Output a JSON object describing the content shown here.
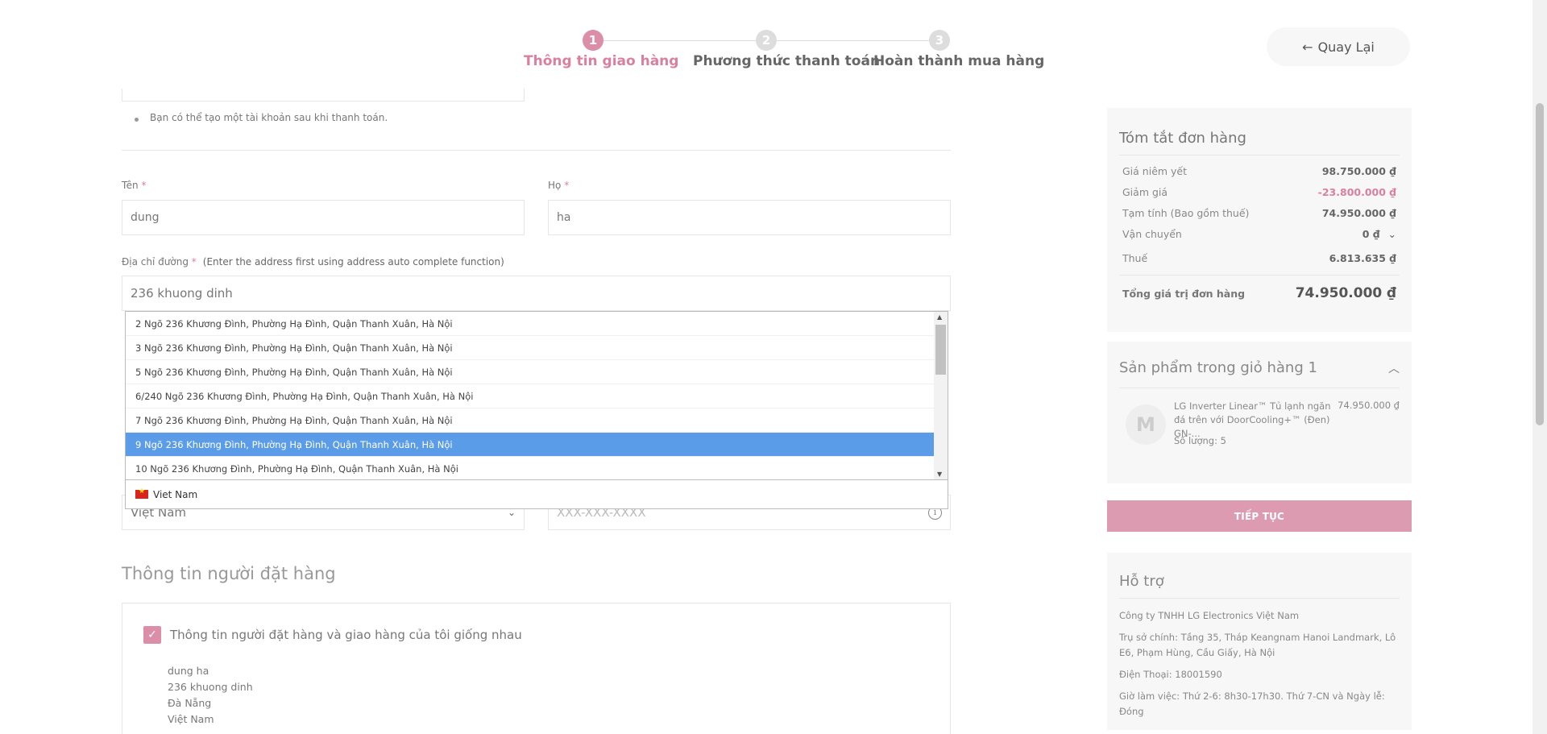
{
  "stepper": {
    "steps": [
      {
        "num": "1",
        "label": "Thông tin giao hàng"
      },
      {
        "num": "2",
        "label": "Phương thức thanh toán"
      },
      {
        "num": "3",
        "label": "Hoàn thành mua hàng"
      }
    ],
    "back_label": "Quay Lại"
  },
  "form": {
    "note": "Bạn có thể tạo một tài khoản sau khi thanh toán.",
    "first_name_label": "Tên",
    "first_name_value": "dung",
    "last_name_label": "Họ",
    "last_name_value": "ha",
    "street_label": "Địa chỉ đường",
    "street_hint": "(Enter the address first using address auto complete function)",
    "street_value": "236 khuong dinh",
    "required_mark": "*",
    "country_value": "Việt Nam",
    "phone_placeholder": "XXX-XXX-XXXX"
  },
  "autocomplete": {
    "items": [
      "2 Ngõ 236 Khương Đình, Phường Hạ Đình, Quận Thanh Xuân, Hà Nội",
      "3 Ngõ 236 Khương Đình, Phường Hạ Đình, Quận Thanh Xuân, Hà Nội",
      "5 Ngõ 236 Khương Đình, Phường Hạ Đình, Quận Thanh Xuân, Hà Nội",
      "6/240 Ngõ 236 Khương Đình, Phường Hạ Đình, Quận Thanh Xuân, Hà Nội",
      "7 Ngõ 236 Khương Đình, Phường Hạ Đình, Quận Thanh Xuân, Hà Nội",
      "9 Ngõ 236 Khương Đình, Phường Hạ Đình, Quận Thanh Xuân, Hà Nội",
      "10 Ngõ 236 Khương Đình, Phường Hạ Đình, Quận Thanh Xuân, Hà Nội"
    ],
    "selected_index": 5,
    "country_option": "Viet Nam"
  },
  "orderer": {
    "title": "Thông tin người đặt hàng",
    "same_label": "Thông tin người đặt hàng và giao hàng của tôi giống nhau",
    "lines": [
      "dung ha",
      "236 khuong dinh",
      "Đà Nẵng",
      "Việt Nam"
    ]
  },
  "summary": {
    "title": "Tóm tắt đơn hàng",
    "rows": [
      {
        "k": "Giá niêm yết",
        "v": "98.750.000 ₫"
      },
      {
        "k": "Giảm giá",
        "v": "-23.800.000 ₫"
      },
      {
        "k": "Tạm tính (Bao gồm thuế)",
        "v": "74.950.000 ₫"
      },
      {
        "k": "Vận chuyển",
        "v": "0 ₫"
      },
      {
        "k": "Thuế",
        "v": "6.813.635 ₫"
      }
    ],
    "total_label": "Tổng giá trị đơn hàng",
    "total_value": "74.950.000 ₫"
  },
  "cart": {
    "title": "Sản phẩm trong giỏ hàng 1",
    "product_name": "LG Inverter Linear™ Tủ lạnh ngăn đá trên với DoorCooling+™ (Đen) GN-...",
    "product_price": "74.950.000 ₫",
    "quantity": "Số lượng: 5"
  },
  "continue_label": "TIẾP TỤC",
  "support": {
    "title": "Hỗ trợ",
    "company": "Công ty TNHH LG Electronics Việt Nam",
    "address": "Trụ sở chính: Tầng 35, Tháp Keangnam Hanoi Landmark, Lô E6, Phạm Hùng, Cầu Giấy, Hà Nội",
    "phone": "Điện Thoại: 18001590",
    "hours": "Giờ làm việc: Thứ 2-6: 8h30-17h30. Thứ 7-CN và Ngày lễ: Đóng"
  },
  "colors": {
    "accent": "#d9809d",
    "selected_row": "#5b9ce8"
  },
  "icons": [
    "arrow-left-icon",
    "chevron-down-icon",
    "chevron-up-icon",
    "info-icon",
    "check-icon",
    "vietnam-flag-icon"
  ]
}
